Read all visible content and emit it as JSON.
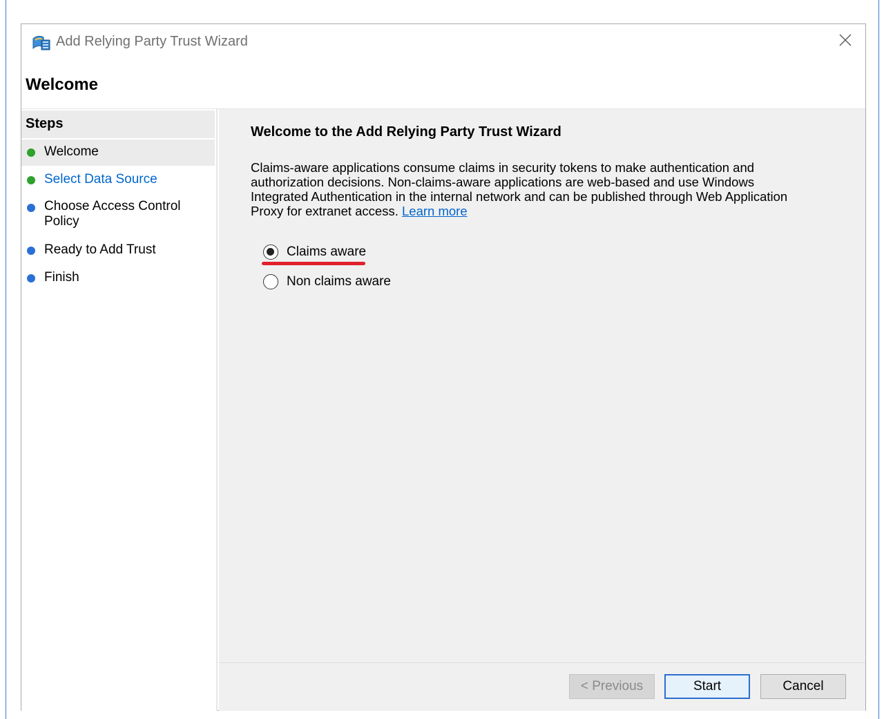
{
  "window": {
    "title": "Add Relying Party Trust Wizard",
    "page_heading": "Welcome"
  },
  "steps": {
    "header": "Steps",
    "items": [
      {
        "label": "Welcome",
        "state": "current",
        "dot_color": "#2ea12e"
      },
      {
        "label": "Select Data Source",
        "state": "link",
        "dot_color": "#2ea12e"
      },
      {
        "label": "Choose Access Control Policy",
        "line1": "Choose Access Control",
        "line2": "Policy",
        "state": "pending",
        "dot_color": "#2a6fd6"
      },
      {
        "label": "Ready to Add Trust",
        "state": "pending",
        "dot_color": "#2a6fd6"
      },
      {
        "label": "Finish",
        "state": "pending",
        "dot_color": "#2a6fd6"
      }
    ]
  },
  "main": {
    "title": "Welcome to the Add Relying Party Trust Wizard",
    "description": "Claims-aware applications consume claims in security tokens to make authentication and authorization decisions. Non-claims-aware applications are web-based and use Windows Integrated Authentication in the internal network and can be published through Web Application Proxy for extranet access.",
    "learn_more": "Learn more",
    "options": [
      {
        "label": "Claims aware",
        "checked": true
      },
      {
        "label": "Non claims aware",
        "checked": false
      }
    ],
    "highlight_color": "#e0202a"
  },
  "buttons": {
    "previous": "< Previous",
    "start": "Start",
    "cancel": "Cancel"
  },
  "icons": {
    "app": "relying-party-trust-icon",
    "close": "close-icon"
  }
}
